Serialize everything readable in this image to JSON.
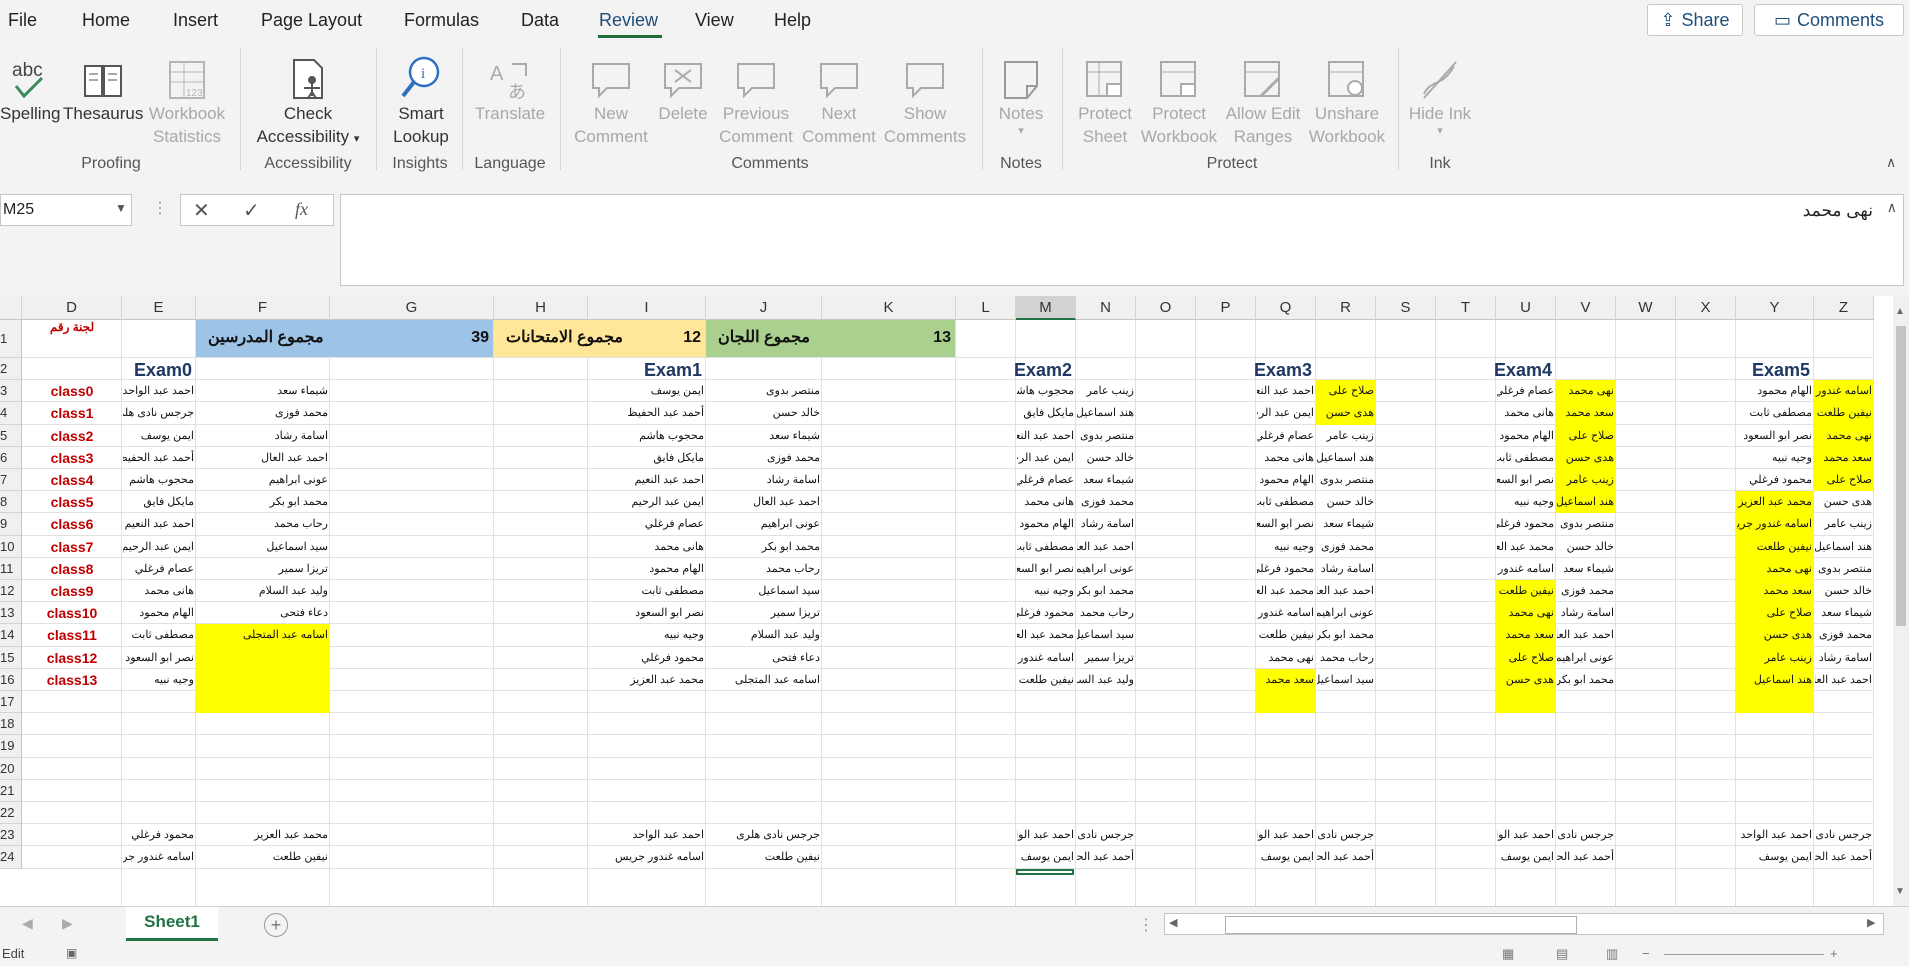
{
  "menu": {
    "items": [
      "File",
      "Home",
      "Insert",
      "Page Layout",
      "Formulas",
      "Data",
      "Review",
      "View",
      "Help"
    ],
    "active": "Review",
    "share_label": "Share",
    "comments_label": "Comments"
  },
  "ribbon": {
    "proofing": {
      "spelling": "Spelling",
      "thesaurus": "Thesaurus",
      "workbook_statistics": "Workbook Statistics"
    },
    "accessibility": {
      "check_accessibility": "Check Accessibility"
    },
    "insights": {
      "smart_lookup": "Smart Lookup"
    },
    "language": {
      "translate": "Translate"
    },
    "comments": {
      "new_comment": "New Comment",
      "delete": "Delete",
      "previous_comment": "Previous Comment",
      "next_comment": "Next Comment",
      "show_comments": "Show Comments"
    },
    "notes": {
      "notes": "Notes"
    },
    "protect": {
      "protect_sheet": "Protect Sheet",
      "protect_workbook": "Protect Workbook",
      "allow_edit_ranges": "Allow Edit Ranges",
      "unshare_workbook": "Unshare Workbook"
    },
    "ink": {
      "hide_ink": "Hide Ink"
    },
    "groups": [
      "Proofing",
      "Accessibility",
      "Insights",
      "Language",
      "Comments",
      "Notes",
      "Protect",
      "Ink"
    ]
  },
  "formula_bar": {
    "name_box": "M25",
    "formula": "نهى محمد"
  },
  "sheet": {
    "columns": [
      "D",
      "E",
      "F",
      "G",
      "H",
      "I",
      "J",
      "K",
      "L",
      "M",
      "N",
      "O",
      "P",
      "Q",
      "R",
      "S",
      "T",
      "U",
      "V",
      "W",
      "X",
      "Y",
      "Z"
    ],
    "selected_column": "M",
    "rows": [
      "1",
      "2",
      "3",
      "4",
      "5",
      "6",
      "7",
      "8",
      "9",
      "10",
      "11",
      "12",
      "13",
      "14",
      "15",
      "16",
      "17",
      "18",
      "19",
      "20",
      "21",
      "22",
      "23",
      "24"
    ],
    "header_label": "لجنة رقم",
    "banner": {
      "teachers_label": "مجموع المدرسين",
      "teachers_total": "39",
      "exam_label": "مجموع الامتحانات",
      "exam_total": "12",
      "committees_label": "مجموع اللجان",
      "committees_total": "13"
    },
    "exam_titles": [
      "Exam0",
      "Exam1",
      "Exam2",
      "Exam3",
      "Exam4",
      "Exam5"
    ],
    "classes": [
      "class0",
      "class1",
      "class2",
      "class3",
      "class4",
      "class5",
      "class6",
      "class7",
      "class8",
      "class9",
      "class10",
      "class11",
      "class12",
      "class13"
    ],
    "exam0": {
      "e": [
        "احمد عبد الواحد",
        "جرجس نادى هلرى",
        "ايمن يوسف",
        "أحمد عبد الحفيظ",
        "محجوب هاشم",
        "مايكل فايق",
        "احمد عبد النعيم",
        "ايمن عبد الرحيم",
        "عصام فرغلي",
        "هانى محمد",
        "الهام محمود",
        "مصطفى ثابت",
        "نصر ابو السعود",
        "وجيه نبيه"
      ],
      "f": [
        "شيماء سعد",
        "محمد فوزى",
        "اسامة رشاد",
        "احمد عبد العال",
        "عونى ابراهيم",
        "محمد ابو بكر",
        "رحاب محمد",
        "سيد اسماعيل",
        "تريزا سمير",
        "وليد عبد السلام",
        "دعاء فتحى",
        "اسامه عبد المتجلى"
      ]
    },
    "exam1": {
      "i": [
        "ايمن يوسف",
        "أحمد عبد الحفيظ",
        "محجوب هاشم",
        "مايكل فايق",
        "احمد عبد النعيم",
        "ايمن عبد الرحيم",
        "عصام فرغلي",
        "هانى محمد",
        "الهام محمود",
        "مصطفى ثابت",
        "نصر ابو السعود",
        "وجيه نبيه",
        "محمود فرغلي",
        "محمد عبد العزيز"
      ],
      "j": [
        "منتصر بدوى",
        "خالد حسن",
        "شيماء سعد",
        "محمد فوزى",
        "اسامة رشاد",
        "احمد عبد العال",
        "عونى ابراهيم",
        "محمد ابو بكر",
        "رحاب محمد",
        "سيد اسماعيل",
        "تريزا سمير",
        "وليد عبد السلام",
        "دعاء فتحى",
        "اسامه عبد المتجلى"
      ]
    },
    "exam2": {
      "m": [
        "محجوب هاشم",
        "مايكل فايق",
        "احمد عبد النعيم",
        "ايمن عبد الرحيم",
        "عصام فرغلي",
        "هانى محمد",
        "الهام محمود",
        "مصطفى ثابت",
        "نصر ابو السعود",
        "وجيه نبيه",
        "محمود فرغلي",
        "محمد عبد العزيز",
        "اسامه غندور جريس",
        "نيفين طلعت"
      ],
      "n": [
        "زينب عامر",
        "هند اسماعيل",
        "منتصر بدوى",
        "خالد حسن",
        "شيماء سعد",
        "محمد فوزى",
        "اسامة رشاد",
        "احمد عبد العال",
        "عونى ابراهيم",
        "محمد ابو بكر",
        "رحاب محمد",
        "سيد اسماعيل",
        "تريزا سمير",
        "وليد عبد السلام"
      ]
    },
    "exam3": {
      "q": [
        "احمد عبد النعيم",
        "ايمن عبد الرحيم",
        "عصام فرغلي",
        "هانى محمد",
        "الهام محمود",
        "مصطفى ثابت",
        "نصر ابو السعود",
        "وجيه نبيه",
        "محمود فرغلي",
        "محمد عبد العزيز",
        "اسامه غندور جريس",
        "نيفين طلعت",
        "نهى محمد",
        "سعد محمد"
      ],
      "r": [
        "صلاح على",
        "هدى حسن",
        "زينب عامر",
        "هند اسماعيل",
        "منتصر بدوى",
        "خالد حسن",
        "شيماء سعد",
        "محمد فوزى",
        "اسامة رشاد",
        "احمد عبد العال",
        "عونى ابراهيم",
        "محمد ابو بكر",
        "رحاب محمد",
        "سيد اسماعيل"
      ]
    },
    "exam4": {
      "u": [
        "عصام فرغلي",
        "هانى محمد",
        "الهام محمود",
        "مصطفى ثابت",
        "نصر ابو السعود",
        "وجيه نبيه",
        "محمود فرغلي",
        "محمد عبد العزيز",
        "اسامه غندور جريس",
        "نيفين طلعت",
        "نهى محمد",
        "سعد محمد",
        "صلاح على",
        "هدى حسن"
      ],
      "v": [
        "نهى محمد",
        "سعد محمد",
        "صلاح على",
        "هدى حسن",
        "زينب عامر",
        "هند اسماعيل",
        "منتصر بدوى",
        "خالد حسن",
        "شيماء سعد",
        "محمد فوزى",
        "اسامة رشاد",
        "احمد عبد العال",
        "عونى ابراهيم",
        "محمد ابو بكر"
      ]
    },
    "exam5": {
      "y": [
        "الهام محمود",
        "مصطفى ثابت",
        "نصر ابو السعود",
        "وجيه نبيه",
        "محمود فرغلي",
        "محمد عبد العزيز",
        "اسامه غندور جريس",
        "نيفين طلعت",
        "نهى محمد",
        "سعد محمد",
        "صلاح على",
        "هدى حسن",
        "زينب عامر",
        "هند اسماعيل"
      ],
      "z": [
        "اسامه غندور",
        "نيفين طلعت",
        "نهى محمد",
        "سعد محمد",
        "صلاح على",
        "هدى حسن",
        "زينب عامر",
        "هند اسماعيل",
        "منتصر بدوى",
        "خالد حسن",
        "شيماء سعد",
        "محمد فوزى",
        "اسامة رشاد",
        "احمد عبد العال"
      ]
    },
    "row23": {
      "e": "محمود فرغلي",
      "f": "محمد عبد العزيز",
      "i": "احمد عبد الواحد",
      "j": "جرجس نادى هلرى",
      "m": "احمد عبد الواحد",
      "n": "جرجس نادى",
      "q": "احمد عبد الواحد",
      "r": "جرجس نادى",
      "u": "احمد عبد الواحد",
      "v": "جرجس نادى",
      "y": "احمد عبد الواحد",
      "z": "جرجس نادى"
    },
    "row24": {
      "e": "اسامه غندور جريس",
      "f": "نيفين طلعت",
      "i": "اسامه غندور جريس",
      "j": "نيفين طلعت",
      "m": "ايمن يوسف",
      "n": "أحمد عبد الحفيظ",
      "q": "ايمن يوسف",
      "r": "أحمد عبد الحفيظ",
      "u": "ايمن يوسف",
      "v": "أحمد عبد الحفيظ",
      "y": "ايمن يوسف",
      "z": "أحمد عبد الحفيظ"
    }
  },
  "tabs": {
    "sheet1": "Sheet1"
  },
  "status": {
    "mode": "Edit"
  },
  "colors": {
    "accent": "#217346",
    "highlight": "#ffff00",
    "blue_banner": "#9dc3e6",
    "gold_banner": "#ffe699",
    "green_banner": "#a9d08e",
    "class_red": "#c00000",
    "exam_title": "#1f3864"
  }
}
